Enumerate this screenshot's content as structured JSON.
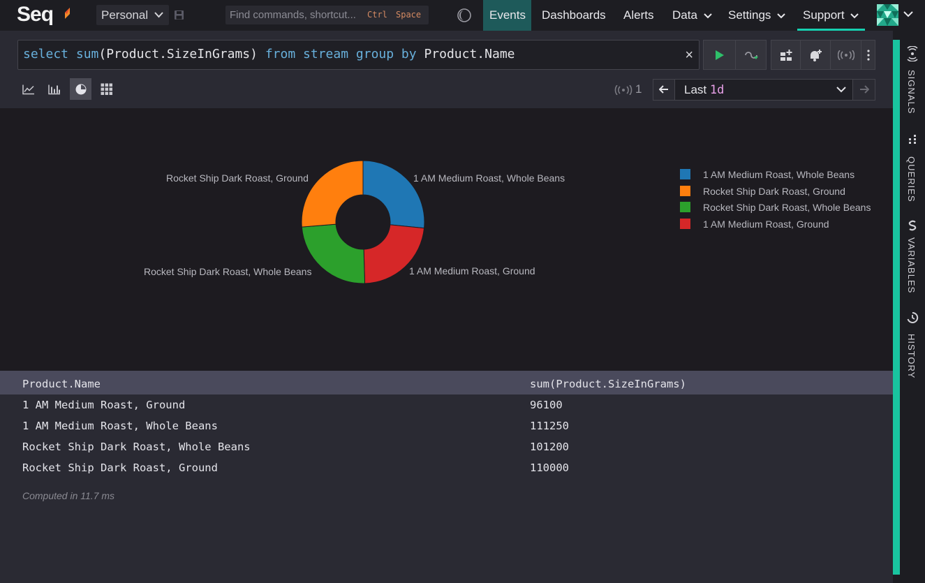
{
  "nav": {
    "logo": "Seq",
    "workspace": "Personal",
    "command_placeholder": "Find commands, shortcut...",
    "shortcut_key1": "Ctrl",
    "shortcut_key2": "Space",
    "items": [
      {
        "label": "Events",
        "active": true
      },
      {
        "label": "Dashboards"
      },
      {
        "label": "Alerts"
      },
      {
        "label": "Data",
        "dropdown": true
      },
      {
        "label": "Settings",
        "dropdown": true
      },
      {
        "label": "Support",
        "dropdown": true
      }
    ]
  },
  "query": {
    "tokens": [
      {
        "t": "select",
        "k": "kw"
      },
      {
        "t": " ",
        "k": "plain"
      },
      {
        "t": "sum",
        "k": "fn"
      },
      {
        "t": "(Product.SizeInGrams) ",
        "k": "plain"
      },
      {
        "t": "from",
        "k": "kw"
      },
      {
        "t": " ",
        "k": "plain"
      },
      {
        "t": "stream",
        "k": "kw"
      },
      {
        "t": " ",
        "k": "plain"
      },
      {
        "t": "group",
        "k": "kw"
      },
      {
        "t": " ",
        "k": "plain"
      },
      {
        "t": "by",
        "k": "kw"
      },
      {
        "t": " Product.Name",
        "k": "plain"
      }
    ],
    "clear": "×"
  },
  "toolbar": {
    "signal_count": "1",
    "range_prefix": "Last ",
    "range_value": "1d"
  },
  "chart_data": {
    "type": "pie",
    "donut": true,
    "categories": [
      "1 AM Medium Roast, Whole Beans",
      "1 AM Medium Roast, Ground",
      "Rocket Ship Dark Roast, Whole Beans",
      "Rocket Ship Dark Roast, Ground"
    ],
    "values": [
      111250,
      96100,
      101200,
      110000
    ],
    "colors": [
      "#1f77b4",
      "#d62728",
      "#2ca02c",
      "#ff7f0e"
    ],
    "legend": {
      "placement": "right",
      "items": [
        {
          "label": "1 AM Medium Roast, Whole Beans",
          "color": "#1f77b4"
        },
        {
          "label": "Rocket Ship Dark Roast, Ground",
          "color": "#ff7f0e"
        },
        {
          "label": "Rocket Ship Dark Roast, Whole Beans",
          "color": "#2ca02c"
        },
        {
          "label": "1 AM Medium Roast, Ground",
          "color": "#d62728"
        }
      ]
    }
  },
  "table": {
    "headers": [
      "Product.Name",
      "sum(Product.SizeInGrams)"
    ],
    "rows": [
      [
        "1 AM Medium Roast, Ground",
        "96100"
      ],
      [
        "1 AM Medium Roast, Whole Beans",
        "111250"
      ],
      [
        "Rocket Ship Dark Roast, Whole Beans",
        "101200"
      ],
      [
        "Rocket Ship Dark Roast, Ground",
        "110000"
      ]
    ],
    "footer": "Computed in 11.7 ms"
  },
  "sidebar": {
    "tabs": [
      {
        "label": "SIGNALS",
        "icon": "signals-icon"
      },
      {
        "label": "QUERIES",
        "icon": "queries-icon"
      },
      {
        "label": "VARIABLES",
        "icon": "variables-icon"
      },
      {
        "label": "HISTORY",
        "icon": "history-icon"
      }
    ]
  },
  "colors": {
    "accent": "#19c49f",
    "active_nav": "#1e5a5a"
  }
}
